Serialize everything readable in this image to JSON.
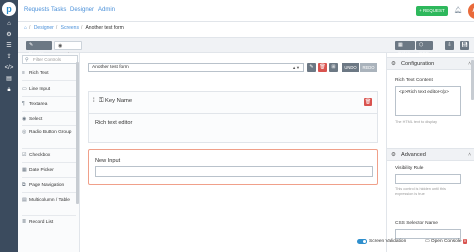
{
  "nav": {
    "logo_letter": "p",
    "icons": [
      "home-icon",
      "gear-icon",
      "list-icon",
      "upload-icon",
      "code-icon",
      "document-icon",
      "lock-icon"
    ]
  },
  "topbar": {
    "menu": [
      "Requests",
      "Tasks",
      "Designer",
      "Admin"
    ],
    "request_label": "+ REQUEST",
    "avatar_initials": "AA"
  },
  "breadcrumb": {
    "items": [
      "Designer",
      "Screens"
    ],
    "current": "Another test form"
  },
  "header": {
    "design_label": "Design",
    "preview_label": "Preview",
    "calcs_label": "Calcs",
    "css_label": "CSS"
  },
  "palette": {
    "filter_placeholder": "Filter Controls",
    "items": [
      {
        "icon": "≡",
        "label": "Rich Text"
      },
      {
        "icon": "▭",
        "label": "Line Input"
      },
      {
        "icon": "¶",
        "label": "Textarea"
      },
      {
        "icon": "◉",
        "label": "Select"
      },
      {
        "icon": "◎",
        "label": "Radio Button Group"
      },
      {
        "icon": "☑",
        "label": "Checkbox"
      },
      {
        "icon": "▦",
        "label": "Date Picker"
      },
      {
        "icon": "⧉",
        "label": "Page Navigation"
      },
      {
        "icon": "▤",
        "label": "Multicolumn / Table"
      },
      {
        "icon": "≣",
        "label": "Record List"
      }
    ]
  },
  "canvas": {
    "form_name": "Another test form",
    "undo_label": "UNDO",
    "redo_label": "REDO",
    "key_name_label": "Key Name",
    "rich_text": "Rich text editor",
    "new_input_label": "New Input"
  },
  "inspector": {
    "config_title": "Configuration",
    "rtc_label": "Rich Text Content",
    "rtc_value": "<p>Rich text editor</p>",
    "rtc_hint": "The HTML text to display",
    "advanced_title": "Advanced",
    "visibility_label": "Visibility Rule",
    "visibility_hint": "This control is hidden until this expression is true",
    "css_selector_label": "CSS Selector Name"
  },
  "footer": {
    "screen_validation": "Screen Validation",
    "open_console": "Open Console",
    "console_count": "0"
  },
  "colors": {
    "nav": "#3b4b5e",
    "accent": "#2f8fcd",
    "success": "#2eb85c",
    "danger": "#d9534f"
  }
}
